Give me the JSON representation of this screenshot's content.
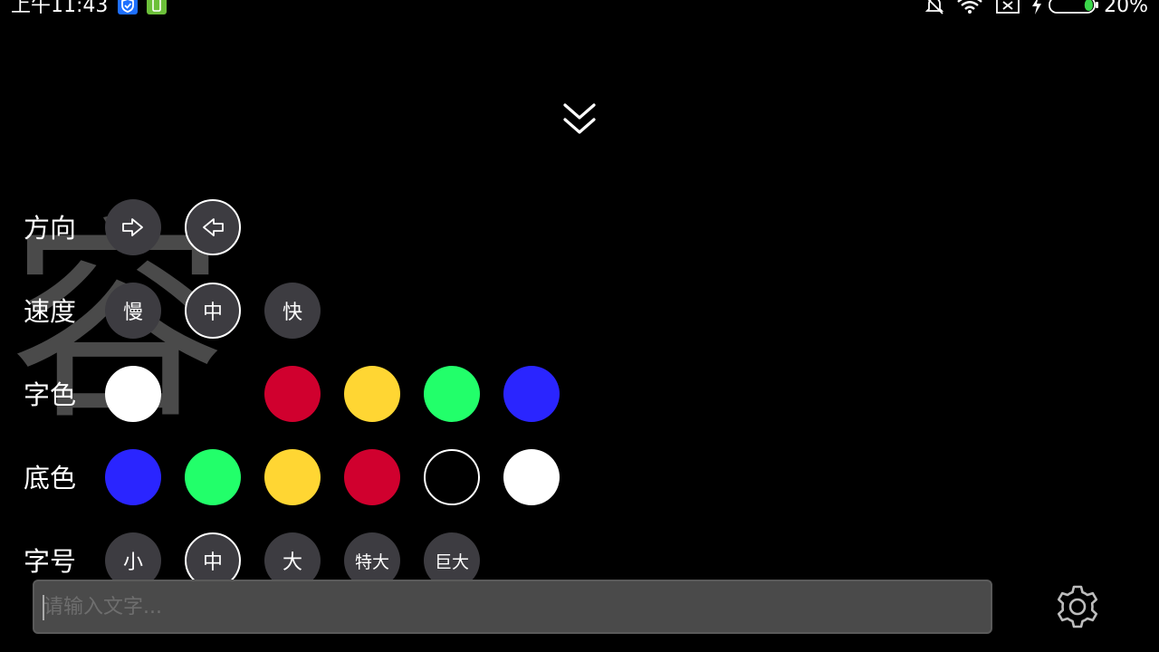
{
  "status_bar": {
    "time": "上午11:43",
    "battery_percent": "20%",
    "battery_level": 0.2,
    "icons": [
      "shield-app-icon",
      "phone-app-icon",
      "bell-off-icon",
      "wifi-icon",
      "sim-none-icon",
      "charging-icon",
      "battery-icon"
    ]
  },
  "marquee": {
    "text": "容",
    "color": "#4a4a4a"
  },
  "collapse": {
    "icon": "double-chevron-down-icon"
  },
  "settings": {
    "direction": {
      "label": "方向",
      "options": [
        {
          "icon": "arrow-right-icon",
          "selected": false
        },
        {
          "icon": "arrow-left-icon",
          "selected": true
        }
      ]
    },
    "speed": {
      "label": "速度",
      "options": [
        {
          "label": "慢",
          "selected": false
        },
        {
          "label": "中",
          "selected": true
        },
        {
          "label": "快",
          "selected": false
        }
      ]
    },
    "text_color": {
      "label": "字色",
      "options": [
        {
          "color": "#ffffff",
          "selected": true
        },
        {
          "color": "#000000",
          "selected": false
        },
        {
          "color": "#d0002e",
          "selected": false
        },
        {
          "color": "#ffd633",
          "selected": false
        },
        {
          "color": "#22ff6a",
          "selected": false
        },
        {
          "color": "#2a25ff",
          "selected": false
        }
      ]
    },
    "bg_color": {
      "label": "底色",
      "options": [
        {
          "color": "#2a25ff",
          "selected": false
        },
        {
          "color": "#22ff6a",
          "selected": false
        },
        {
          "color": "#ffd633",
          "selected": false
        },
        {
          "color": "#d0002e",
          "selected": false
        },
        {
          "color": "#000000",
          "selected": true
        },
        {
          "color": "#ffffff",
          "selected": false
        }
      ]
    },
    "font_size": {
      "label": "字号",
      "options": [
        {
          "label": "小",
          "selected": false
        },
        {
          "label": "中",
          "selected": true
        },
        {
          "label": "大",
          "selected": false
        },
        {
          "label": "特大",
          "selected": false
        },
        {
          "label": "巨大",
          "selected": false
        }
      ]
    }
  },
  "input": {
    "placeholder": "请输入文字...",
    "value": ""
  },
  "settings_button": {
    "icon": "gear-icon"
  }
}
